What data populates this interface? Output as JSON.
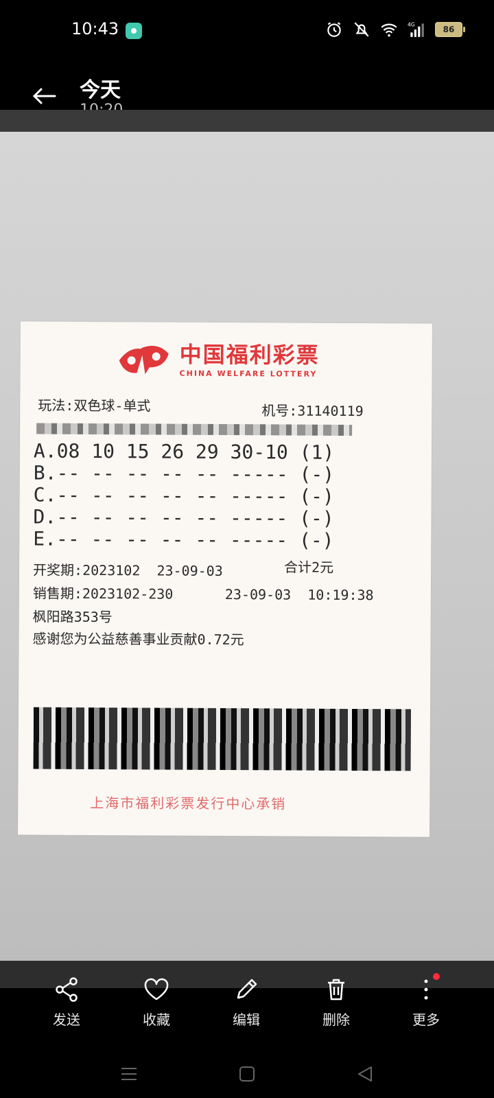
{
  "status": {
    "time": "10:43",
    "battery": "86",
    "network": "4G"
  },
  "header": {
    "title": "今天",
    "subtitle": "10:20"
  },
  "ticket": {
    "logo_cn": "中国福利彩票",
    "logo_en": "CHINA WELFARE LOTTERY",
    "play_type": "玩法:双色球-单式",
    "machine_no": "机号:31140119",
    "lines": [
      "A.08 10 15 26 29 30-10 (1)",
      "B.-- -- -- -- -- ----- (-)",
      "C.-- -- -- -- -- ----- (-)",
      "D.-- -- -- -- -- ----- (-)",
      "E.-- -- -- -- -- ----- (-)"
    ],
    "draw_period": "开奖期:2023102  23-09-03",
    "total": "合计2元",
    "sale_period": "销售期:2023102-230",
    "sale_time": "23-09-03  10:19:38",
    "address": "枫阳路353号",
    "thanks": "感谢您为公益慈善事业贡献0.72元",
    "issuer": "上海市福利彩票发行中心承销"
  },
  "toolbar": [
    {
      "label": "发送",
      "icon": "share-icon"
    },
    {
      "label": "收藏",
      "icon": "heart-icon"
    },
    {
      "label": "编辑",
      "icon": "pencil-icon"
    },
    {
      "label": "删除",
      "icon": "trash-icon"
    },
    {
      "label": "更多",
      "icon": "more-icon"
    }
  ]
}
